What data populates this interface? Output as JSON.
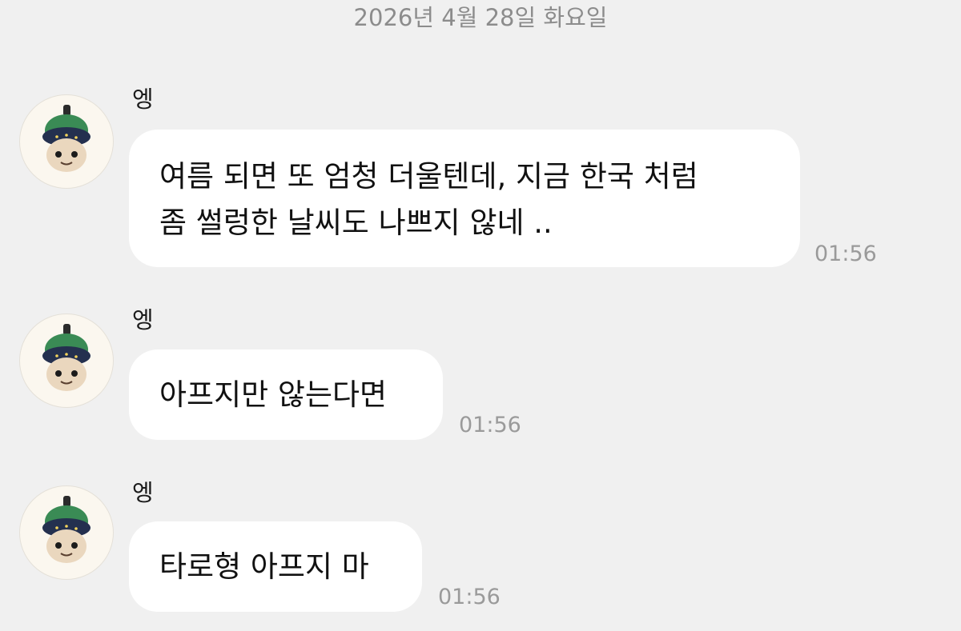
{
  "date_divider": "2026년 4월 28일 화요일",
  "messages": [
    {
      "sender": "엥",
      "text": "여름 되면 또 엄청 더울텐데, 지금 한국 처럼\n좀 썰렁한 날씨도 나쁘지 않네 ..",
      "time": "01:56"
    },
    {
      "sender": "엥",
      "text": "아프지만 않는다면",
      "time": "01:56"
    },
    {
      "sender": "엥",
      "text": "타로형 아프지 마",
      "time": "01:56"
    }
  ],
  "colors": {
    "background": "#f0f0f0",
    "bubble": "#ffffff",
    "timestamp": "#9a9a9a",
    "date_divider": "#8c8c8c"
  },
  "icons": {
    "avatar": "plush-character-avatar-icon"
  }
}
